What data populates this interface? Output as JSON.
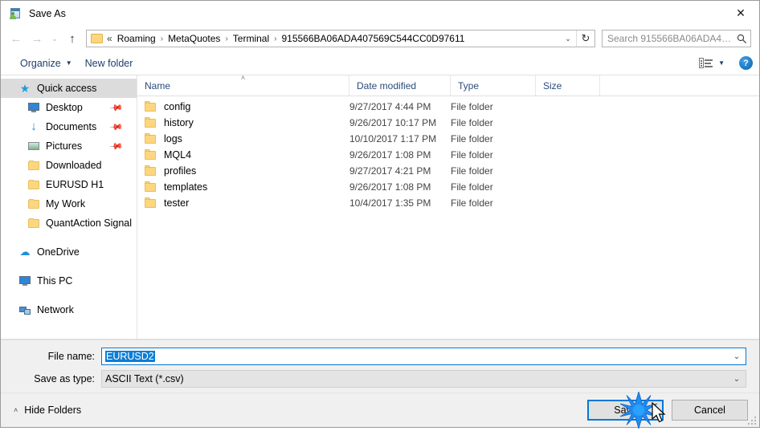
{
  "window": {
    "title": "Save As",
    "icon": "save-as-dialog-icon",
    "close_label": "✕"
  },
  "nav": {
    "back_icon": "←",
    "forward_icon": "→",
    "recent_icon": "⌄",
    "up_icon": "↑",
    "refresh_icon": "↻",
    "dropdown_icon": "⌄",
    "breadcrumb_ellipsis": "«",
    "breadcrumbs": [
      "Roaming",
      "MetaQuotes",
      "Terminal",
      "915566BA06ADA407569C544CC0D97611"
    ],
    "separator": "›"
  },
  "search": {
    "placeholder": "Search 915566BA06ADA40756...",
    "icon": "search-icon"
  },
  "toolbar": {
    "organize_label": "Organize",
    "organize_caret": "▼",
    "new_folder_label": "New folder",
    "view_caret": "▼",
    "help_label": "?"
  },
  "sidebar": {
    "items": [
      {
        "label": "Quick access",
        "icon": "star-icon",
        "selected": true,
        "indent": false,
        "pinned": false
      },
      {
        "label": "Desktop",
        "icon": "monitor-icon",
        "selected": false,
        "indent": true,
        "pinned": true
      },
      {
        "label": "Documents",
        "icon": "download-arrow-icon",
        "selected": false,
        "indent": true,
        "pinned": true
      },
      {
        "label": "Pictures",
        "icon": "picture-icon",
        "selected": false,
        "indent": true,
        "pinned": true
      },
      {
        "label": "Downloaded",
        "icon": "folder-icon",
        "selected": false,
        "indent": true,
        "pinned": false
      },
      {
        "label": "EURUSD H1",
        "icon": "folder-icon",
        "selected": false,
        "indent": true,
        "pinned": false
      },
      {
        "label": "My Work",
        "icon": "folder-icon",
        "selected": false,
        "indent": true,
        "pinned": false
      },
      {
        "label": "QuantAction Signal",
        "icon": "folder-icon",
        "selected": false,
        "indent": true,
        "pinned": false
      },
      {
        "label": "OneDrive",
        "icon": "cloud-icon",
        "selected": false,
        "indent": false,
        "pinned": false
      },
      {
        "label": "This PC",
        "icon": "computer-icon",
        "selected": false,
        "indent": false,
        "pinned": false
      },
      {
        "label": "Network",
        "icon": "network-icon",
        "selected": false,
        "indent": false,
        "pinned": false
      }
    ],
    "pin_glyph": "📌"
  },
  "filelist": {
    "columns": [
      "Name",
      "Date modified",
      "Type",
      "Size"
    ],
    "sort_caret": "˄",
    "rows": [
      {
        "name": "config",
        "date": "9/27/2017 4:44 PM",
        "type": "File folder",
        "size": ""
      },
      {
        "name": "history",
        "date": "9/26/2017 10:17 PM",
        "type": "File folder",
        "size": ""
      },
      {
        "name": "logs",
        "date": "10/10/2017 1:17 PM",
        "type": "File folder",
        "size": ""
      },
      {
        "name": "MQL4",
        "date": "9/26/2017 1:08 PM",
        "type": "File folder",
        "size": ""
      },
      {
        "name": "profiles",
        "date": "9/27/2017 4:21 PM",
        "type": "File folder",
        "size": ""
      },
      {
        "name": "templates",
        "date": "9/26/2017 1:08 PM",
        "type": "File folder",
        "size": ""
      },
      {
        "name": "tester",
        "date": "10/4/2017 1:35 PM",
        "type": "File folder",
        "size": ""
      }
    ]
  },
  "form": {
    "filename_label": "File name:",
    "filename_value": "EURUSD2",
    "filetype_label": "Save as type:",
    "filetype_value": "ASCII Text (*.csv)",
    "dropdown_icon": "⌄"
  },
  "footer": {
    "hide_folders_label": "Hide Folders",
    "hide_folders_caret": "˄",
    "save_label": "Save",
    "cancel_label": "Cancel"
  },
  "colors": {
    "accent": "#0078d7",
    "selection": "#0c7dd6",
    "folder": "#fcd77f",
    "breadcrumb_text": "#000000",
    "column_header_text": "#2c4b79",
    "toolbar_link": "#1d3f6e",
    "dialog_bg": "#f0f0f0"
  }
}
